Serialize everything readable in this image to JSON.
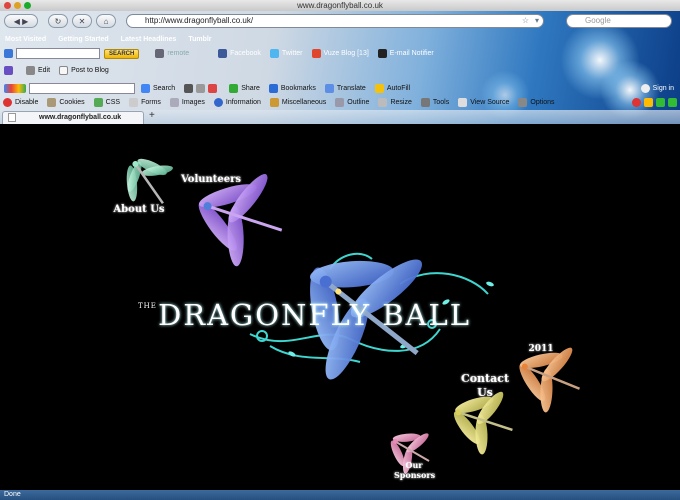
{
  "window": {
    "title": "www.dragonflyball.co.uk"
  },
  "navigation": {
    "url": "http://www.dragonflyball.co.uk/",
    "search_placeholder": "Google"
  },
  "bookmarks": [
    "Most Visited",
    "Getting Started",
    "Latest Headlines",
    "Tumblr"
  ],
  "toolbar1": {
    "search_button": "SEARCH",
    "remote": "remote",
    "items": [
      "Facebook",
      "Twitter",
      "Vuze Blog [13]",
      "E-mail Notifier"
    ]
  },
  "toolbar2": {
    "items": [
      "Edit",
      "Post to Blog"
    ]
  },
  "toolbar3": {
    "items": [
      "Search",
      "Share",
      "Bookmarks",
      "Translate",
      "AutoFill"
    ],
    "signin": "Sign in"
  },
  "webdev": {
    "items": [
      "Disable",
      "Cookies",
      "CSS",
      "Forms",
      "Images",
      "Information",
      "Miscellaneous",
      "Outline",
      "Resize",
      "Tools",
      "View Source",
      "Options"
    ]
  },
  "tab": {
    "label": "www.dragonflyball.co.uk"
  },
  "site": {
    "logo_prefix": "THE",
    "logo_text": "DRAGONFLY BALL",
    "nav": {
      "about": "About Us",
      "volunteers": "Volunteers",
      "contact": "Contact Us",
      "year": "2011",
      "sponsors": "Our Sponsors"
    }
  },
  "status": {
    "text": "Done"
  },
  "colors": {
    "accent_blue": "#2f78c0",
    "status_blue": "#27507e",
    "cyan_swirl": "#3fd6d0"
  }
}
